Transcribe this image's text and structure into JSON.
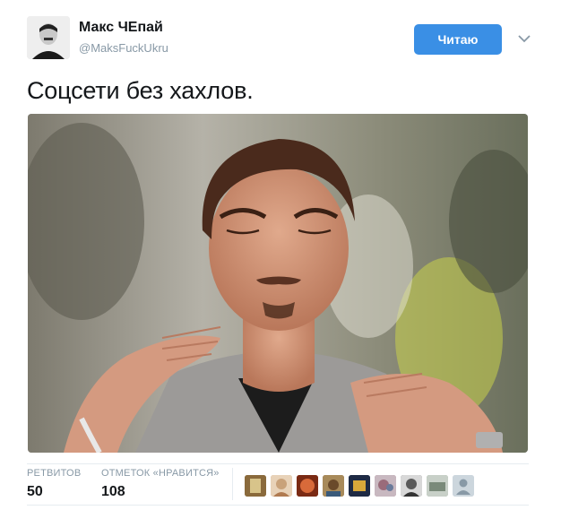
{
  "tweet": {
    "author": {
      "display_name": "Макс ЧЕпай",
      "handle": "@MaksFuckUkru"
    },
    "follow_button_label": "Читаю",
    "text": "Соцсети без хахлов.",
    "stats": {
      "retweets_label": "РЕТВИТОВ",
      "retweets_count": "50",
      "likes_label": "ОТМЕТОК «НРАВИТСЯ»",
      "likes_count": "108"
    },
    "likers": [
      {
        "icon": "avatar-1",
        "color": "#8a6a3c"
      },
      {
        "icon": "avatar-2",
        "color": "#c9a27a"
      },
      {
        "icon": "avatar-3",
        "color": "#b8502e"
      },
      {
        "icon": "avatar-4",
        "color": "#7a5a3a"
      },
      {
        "icon": "avatar-5",
        "color": "#2f3b5a"
      },
      {
        "icon": "avatar-6",
        "color": "#9a6b7a"
      },
      {
        "icon": "avatar-7",
        "color": "#5a5a5a"
      },
      {
        "icon": "avatar-8",
        "color": "#8a9a8a"
      },
      {
        "icon": "default-avatar-icon",
        "color": "#ccd6dd"
      }
    ]
  },
  "colors": {
    "accent": "#3a8fe5",
    "muted_text": "#8899a6",
    "divider": "#e6ecf0"
  }
}
